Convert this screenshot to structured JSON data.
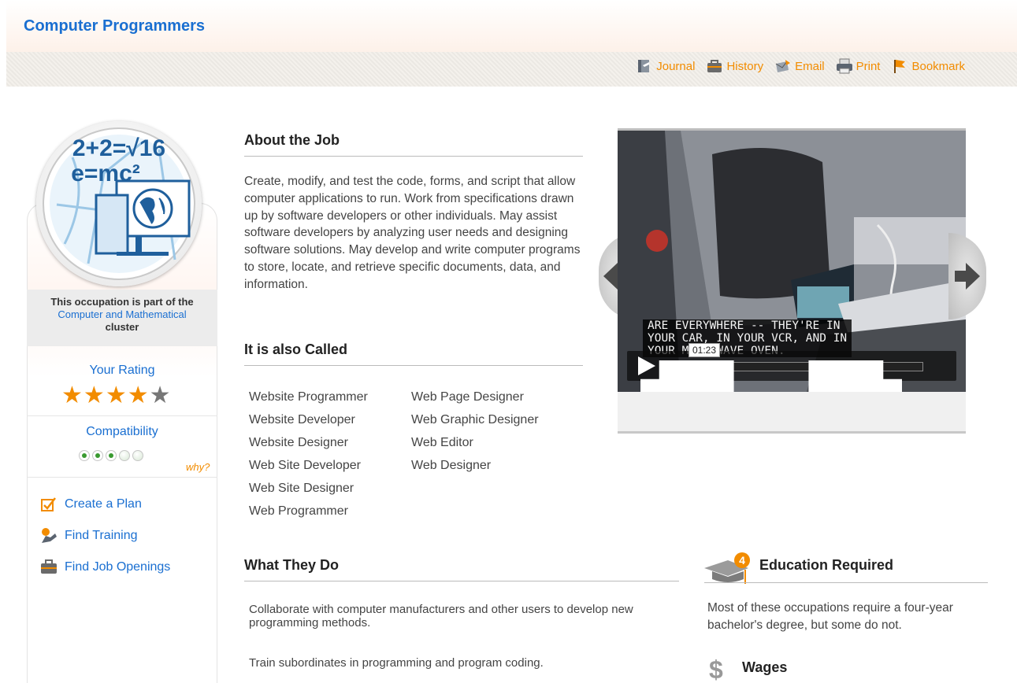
{
  "page": {
    "title": "Computer Programmers"
  },
  "actions": [
    {
      "label": "Journal",
      "icon": "journal-icon"
    },
    {
      "label": "History",
      "icon": "history-icon"
    },
    {
      "label": "Email",
      "icon": "email-icon"
    },
    {
      "label": "Print",
      "icon": "print-icon"
    },
    {
      "label": "Bookmark",
      "icon": "bookmark-icon"
    }
  ],
  "sidebar": {
    "logo_text_line1": "2+2=√16",
    "logo_text_line2": "e=mc²",
    "cluster_line1": "This occupation is part of the",
    "cluster_link": "Computer and Mathematical",
    "cluster_line3": "cluster",
    "rating_label": "Your Rating",
    "rating_value": 4,
    "rating_max": 5,
    "compat_label": "Compatibility",
    "compat_value": 3,
    "compat_max": 5,
    "why": "why?",
    "links": [
      {
        "label": "Create a Plan",
        "icon": "checklist-icon"
      },
      {
        "label": "Find Training",
        "icon": "training-icon"
      },
      {
        "label": "Find Job Openings",
        "icon": "briefcase-icon"
      }
    ]
  },
  "about": {
    "heading": "About the Job",
    "text": "Create, modify, and test the code, forms, and script that allow computer applications to run. Work from specifications drawn up by software developers or other individuals. May assist software developers by analyzing user needs and designing software solutions. May develop and write computer programs to store, locate, and retrieve specific documents, data, and information."
  },
  "also_called": {
    "heading": "It is also Called",
    "col1": [
      "Website Programmer",
      "Website Developer",
      "Website Designer",
      "Web Site Developer",
      "Web Site Designer",
      "Web Programmer"
    ],
    "col2": [
      "Web Page Designer",
      "Web Graphic Designer",
      "Web Editor",
      "Web Designer"
    ]
  },
  "video": {
    "subtitle_line1": "ARE EVERYWHERE -- THEY'RE IN",
    "subtitle_line2": "YOUR CAR, IN YOUR VCR, AND IN",
    "subtitle_line3": "YOUR MICROWAVE OVEN.",
    "time": "01:23"
  },
  "what_they_do": {
    "heading": "What They Do",
    "items": [
      "Collaborate with computer manufacturers and other users to develop new programming methods.",
      "Train subordinates in programming and program coding."
    ]
  },
  "education": {
    "heading": "Education Required",
    "badge": "4",
    "text": "Most of these occupations require a four-year bachelor's degree, but some do not."
  },
  "wages": {
    "heading": "Wages",
    "icon": "dollar-icon"
  },
  "colors": {
    "link": "#1a6fd1",
    "accent": "#f28c00",
    "star_off": "#777777"
  }
}
